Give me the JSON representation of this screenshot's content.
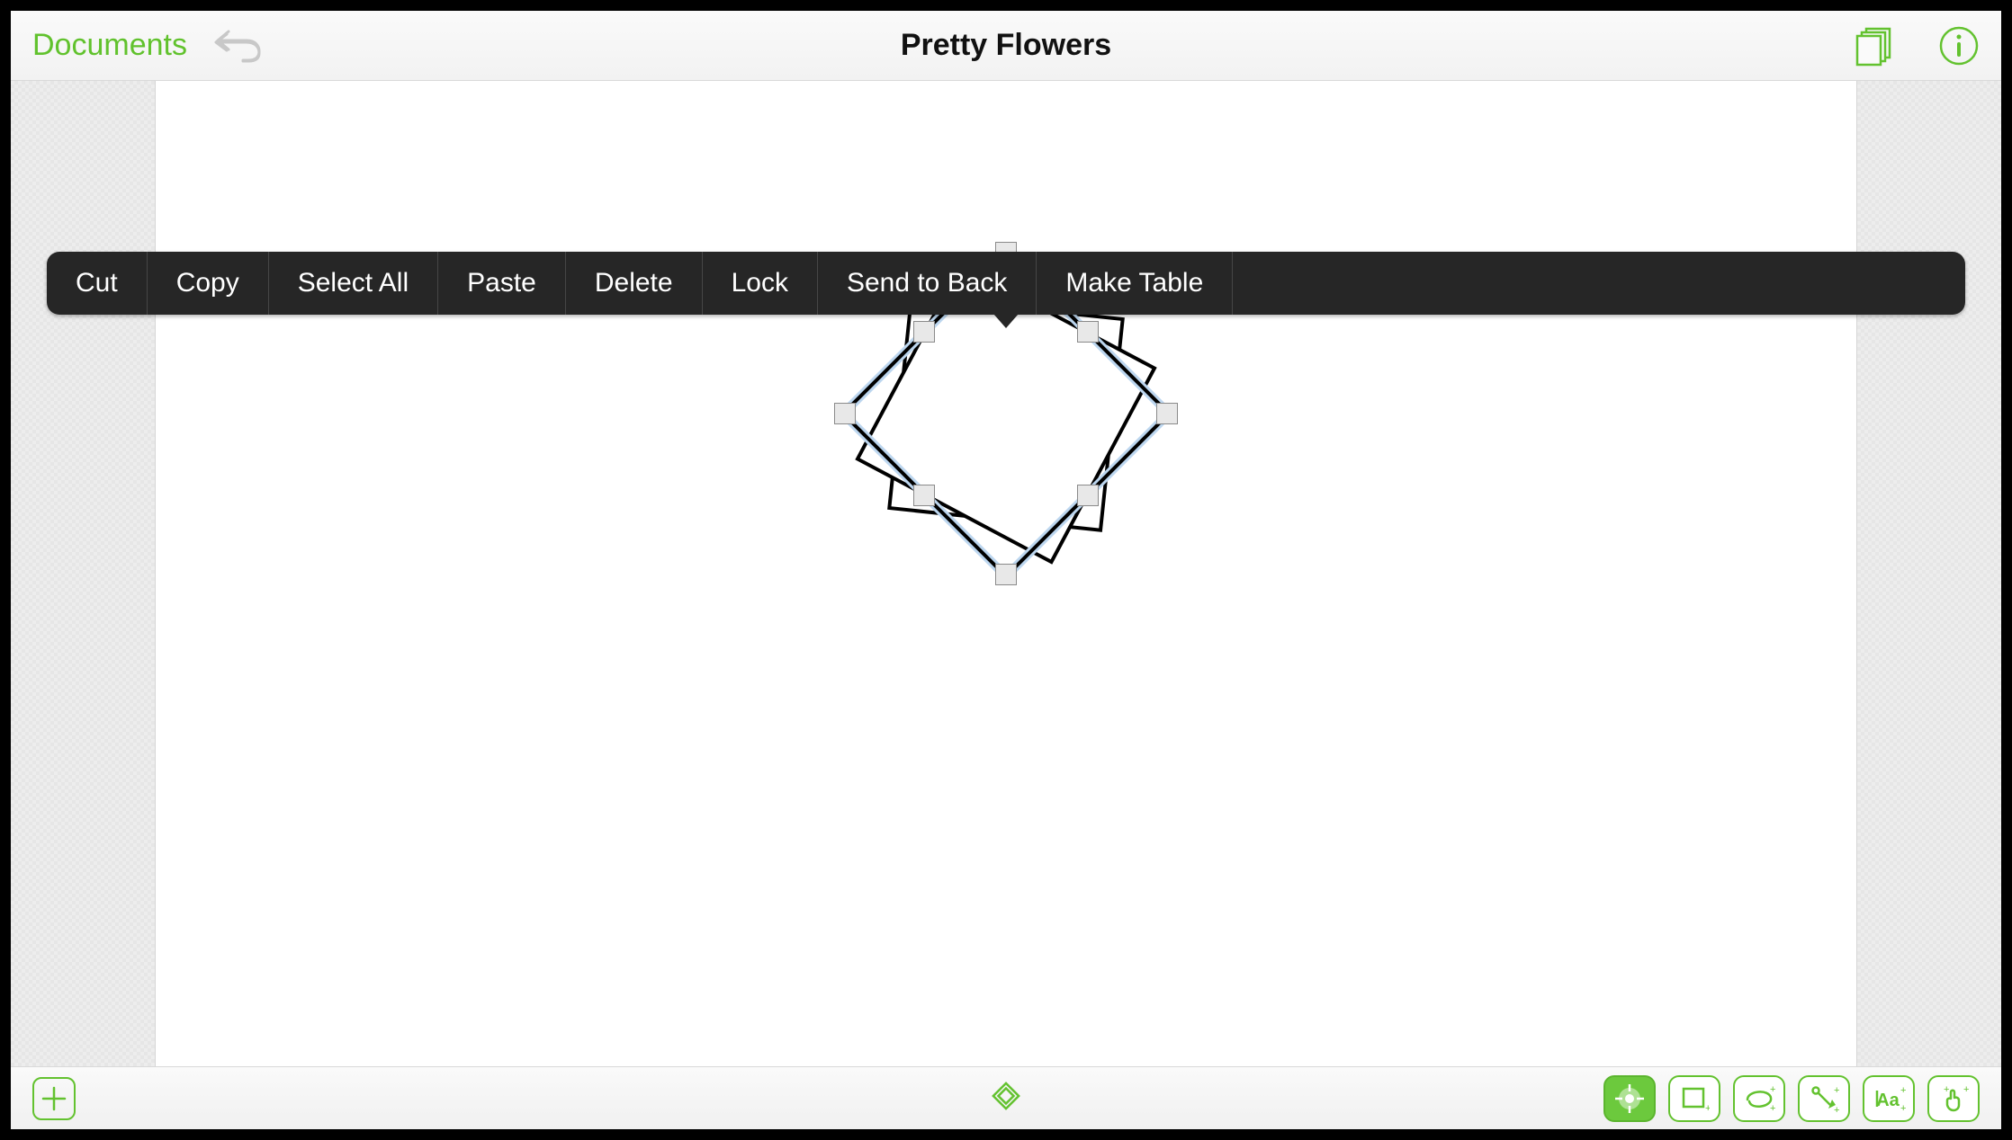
{
  "header": {
    "documents_label": "Documents",
    "title": "Pretty Flowers"
  },
  "context_menu": {
    "items": [
      "Cut",
      "Copy",
      "Select All",
      "Paste",
      "Delete",
      "Lock",
      "Send to Back",
      "Make Table"
    ]
  },
  "colors": {
    "accent": "#63c22f"
  },
  "tools": {
    "active": "drawing-mode"
  }
}
